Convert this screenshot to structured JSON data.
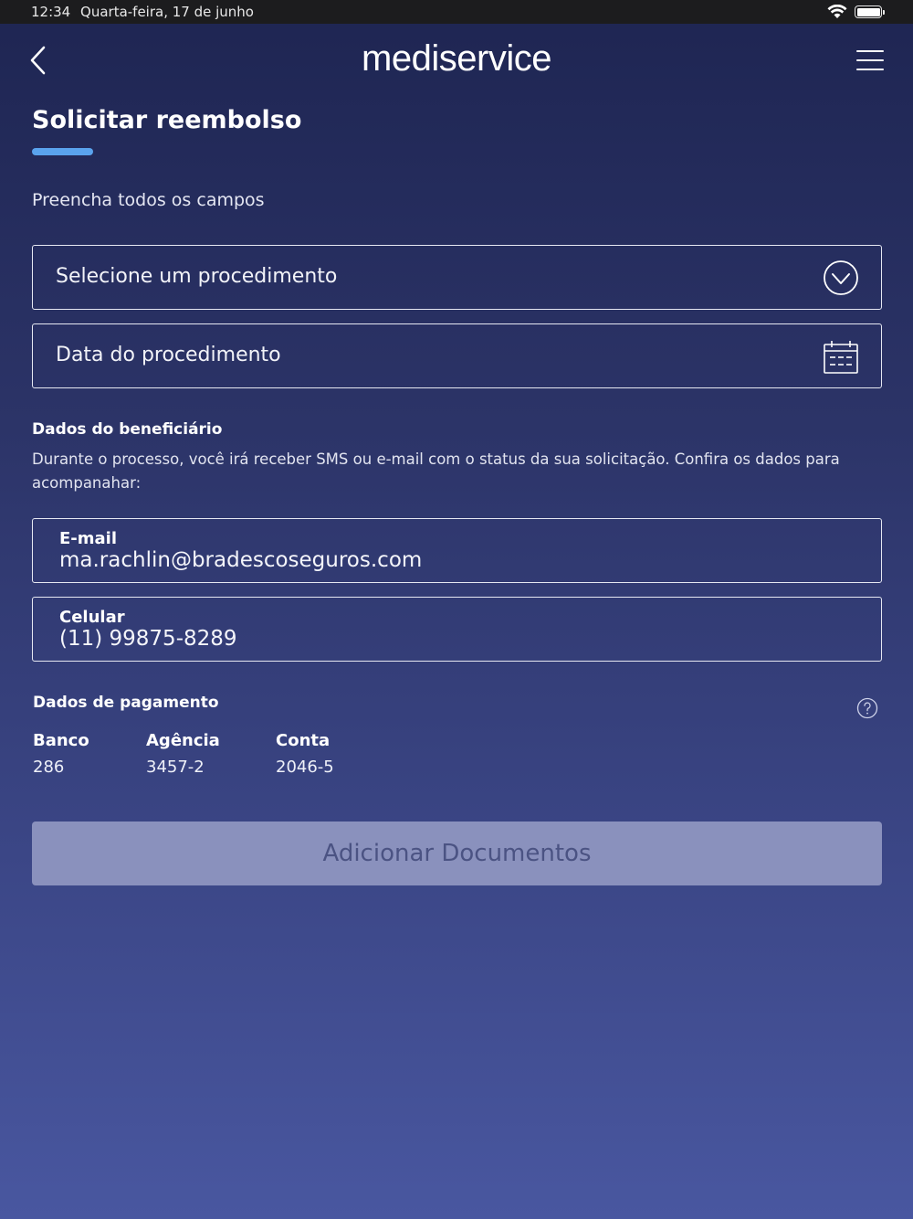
{
  "status_bar": {
    "time": "12:34",
    "date": "Quarta-feira, 17 de junho",
    "wifi_icon": "wifi-icon",
    "battery_icon": "battery-icon",
    "battery_level": 1.0
  },
  "header": {
    "logo_text": "mediservice",
    "back_icon": "chevron-left-icon",
    "menu_icon": "hamburger-menu-icon"
  },
  "page": {
    "title": "Solicitar reembolso",
    "accent_color": "#5aa3ee",
    "instructions": "Preencha todos os campos"
  },
  "form": {
    "procedure_select": {
      "placeholder": "Selecione um procedimento",
      "icon": "chevron-down-circle-icon"
    },
    "procedure_date": {
      "placeholder": "Data do procedimento",
      "icon": "calendar-icon"
    }
  },
  "beneficiary": {
    "title": "Dados do beneficiário",
    "description": "Durante o processo, você irá receber SMS ou e-mail com o status da sua solicitação. Confira os dados para acompanahar:",
    "email": {
      "label": "E-mail",
      "value": "ma.rachlin@bradescoseguros.com"
    },
    "phone": {
      "label": "Celular",
      "value": "(11) 99875-8289"
    }
  },
  "payment": {
    "title": "Dados de pagamento",
    "help_icon": "question-circle-icon",
    "columns": [
      {
        "label": "Banco",
        "value": "286"
      },
      {
        "label": "Agência",
        "value": "3457-2"
      },
      {
        "label": "Conta",
        "value": "2046-5"
      }
    ]
  },
  "actions": {
    "add_documents_label": "Adicionar Documentos",
    "button_state": "disabled"
  }
}
